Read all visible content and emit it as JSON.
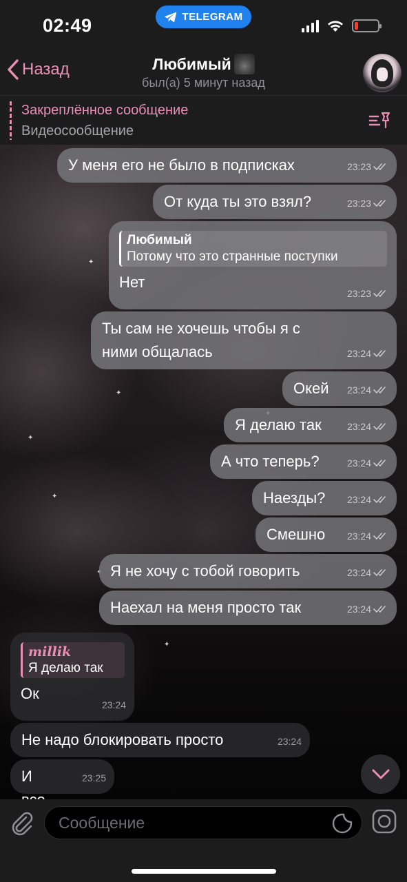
{
  "status_bar": {
    "time": "02:49",
    "app_pill": "TELEGRAM",
    "battery_level_fraction": 0.15
  },
  "header": {
    "back_label": "Назад",
    "title": "Любимый",
    "subtitle": "был(а) 5 минут назад"
  },
  "pinned": {
    "title": "Закреплённое сообщение",
    "text": "Видеосообщение"
  },
  "messages": [
    {
      "dir": "out",
      "text": "У меня его не было в подписках",
      "time": "23:23"
    },
    {
      "dir": "out",
      "text": "От куда ты это взял?",
      "time": "23:23"
    },
    {
      "dir": "out",
      "reply_name": "Любимый",
      "reply_text": "Потому что это странные поступки",
      "text": "Нет",
      "time": "23:23"
    },
    {
      "dir": "out",
      "text": "Ты сам не хочешь чтобы я с ними общалась",
      "time": "23:24"
    },
    {
      "dir": "out",
      "text": "Окей",
      "time": "23:24"
    },
    {
      "dir": "out",
      "text": "Я делаю так",
      "time": "23:24"
    },
    {
      "dir": "out",
      "text": "А что теперь?",
      "time": "23:24"
    },
    {
      "dir": "out",
      "text": "Наезды?",
      "time": "23:24"
    },
    {
      "dir": "out",
      "text": "Смешно",
      "time": "23:24"
    },
    {
      "dir": "out",
      "text": "Я не хочу с тобой говорить",
      "time": "23:24"
    },
    {
      "dir": "out",
      "text": "Наехал на меня просто так",
      "time": "23:24"
    },
    {
      "dir": "in",
      "reply_name": "millik",
      "reply_text": "Я делаю так",
      "text": "Ок",
      "time": "23:24"
    },
    {
      "dir": "in",
      "text": "Не надо блокировать просто",
      "time": "23:24"
    },
    {
      "dir": "in",
      "text": "И все",
      "time": "23:25"
    }
  ],
  "input": {
    "placeholder": "Сообщение"
  },
  "colors": {
    "accent": "#e98fb6",
    "telegram_blue": "#1f82ef",
    "bar_bg": "#1c1c1d"
  }
}
